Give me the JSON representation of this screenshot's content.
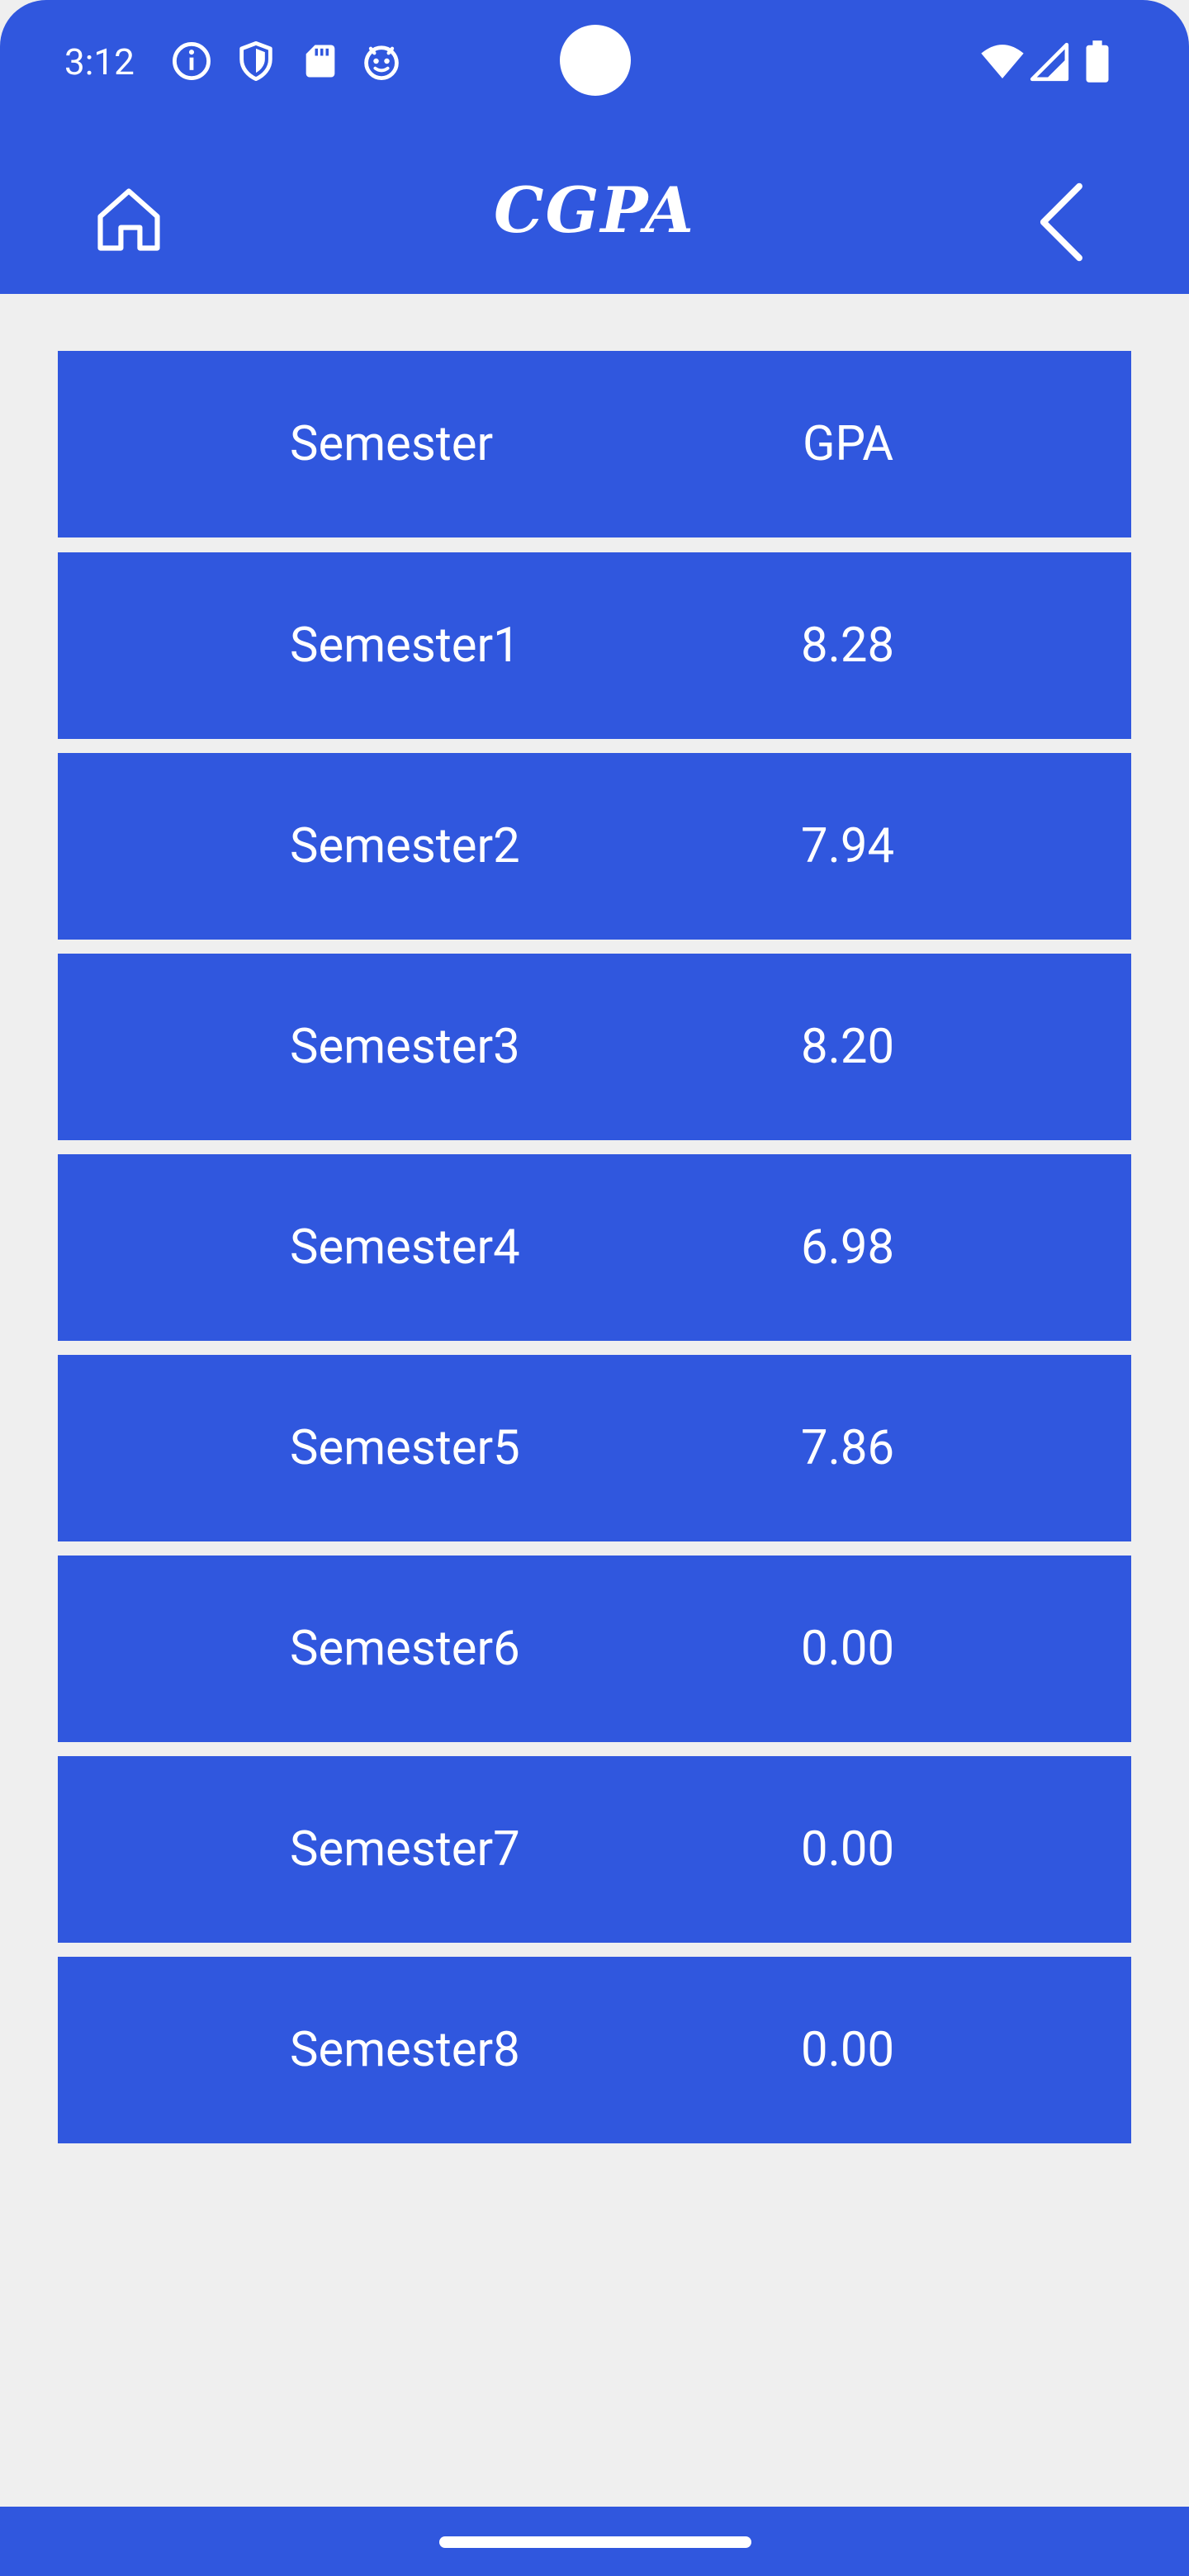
{
  "status_bar": {
    "time": "3:12",
    "left_icons": [
      "info-icon",
      "shield-icon",
      "sd-card-icon",
      "android-face-icon"
    ],
    "right_icons": [
      "wifi-icon",
      "cell-signal-icon",
      "battery-icon"
    ]
  },
  "app_bar": {
    "title": "CGPA",
    "home_icon": "home-icon",
    "back_icon": "back-chevron-icon"
  },
  "table": {
    "headers": {
      "semester": "Semester",
      "gpa": "GPA"
    },
    "rows": [
      {
        "semester": "Semester1",
        "gpa": "8.28"
      },
      {
        "semester": "Semester2",
        "gpa": "7.94"
      },
      {
        "semester": "Semester3",
        "gpa": "8.20"
      },
      {
        "semester": "Semester4",
        "gpa": "6.98"
      },
      {
        "semester": "Semester5",
        "gpa": "7.86"
      },
      {
        "semester": "Semester6",
        "gpa": "0.00"
      },
      {
        "semester": "Semester7",
        "gpa": "0.00"
      },
      {
        "semester": "Semester8",
        "gpa": "0.00"
      }
    ]
  },
  "colors": {
    "primary": "#3057de",
    "background": "#efefef",
    "text": "#ffffff"
  }
}
